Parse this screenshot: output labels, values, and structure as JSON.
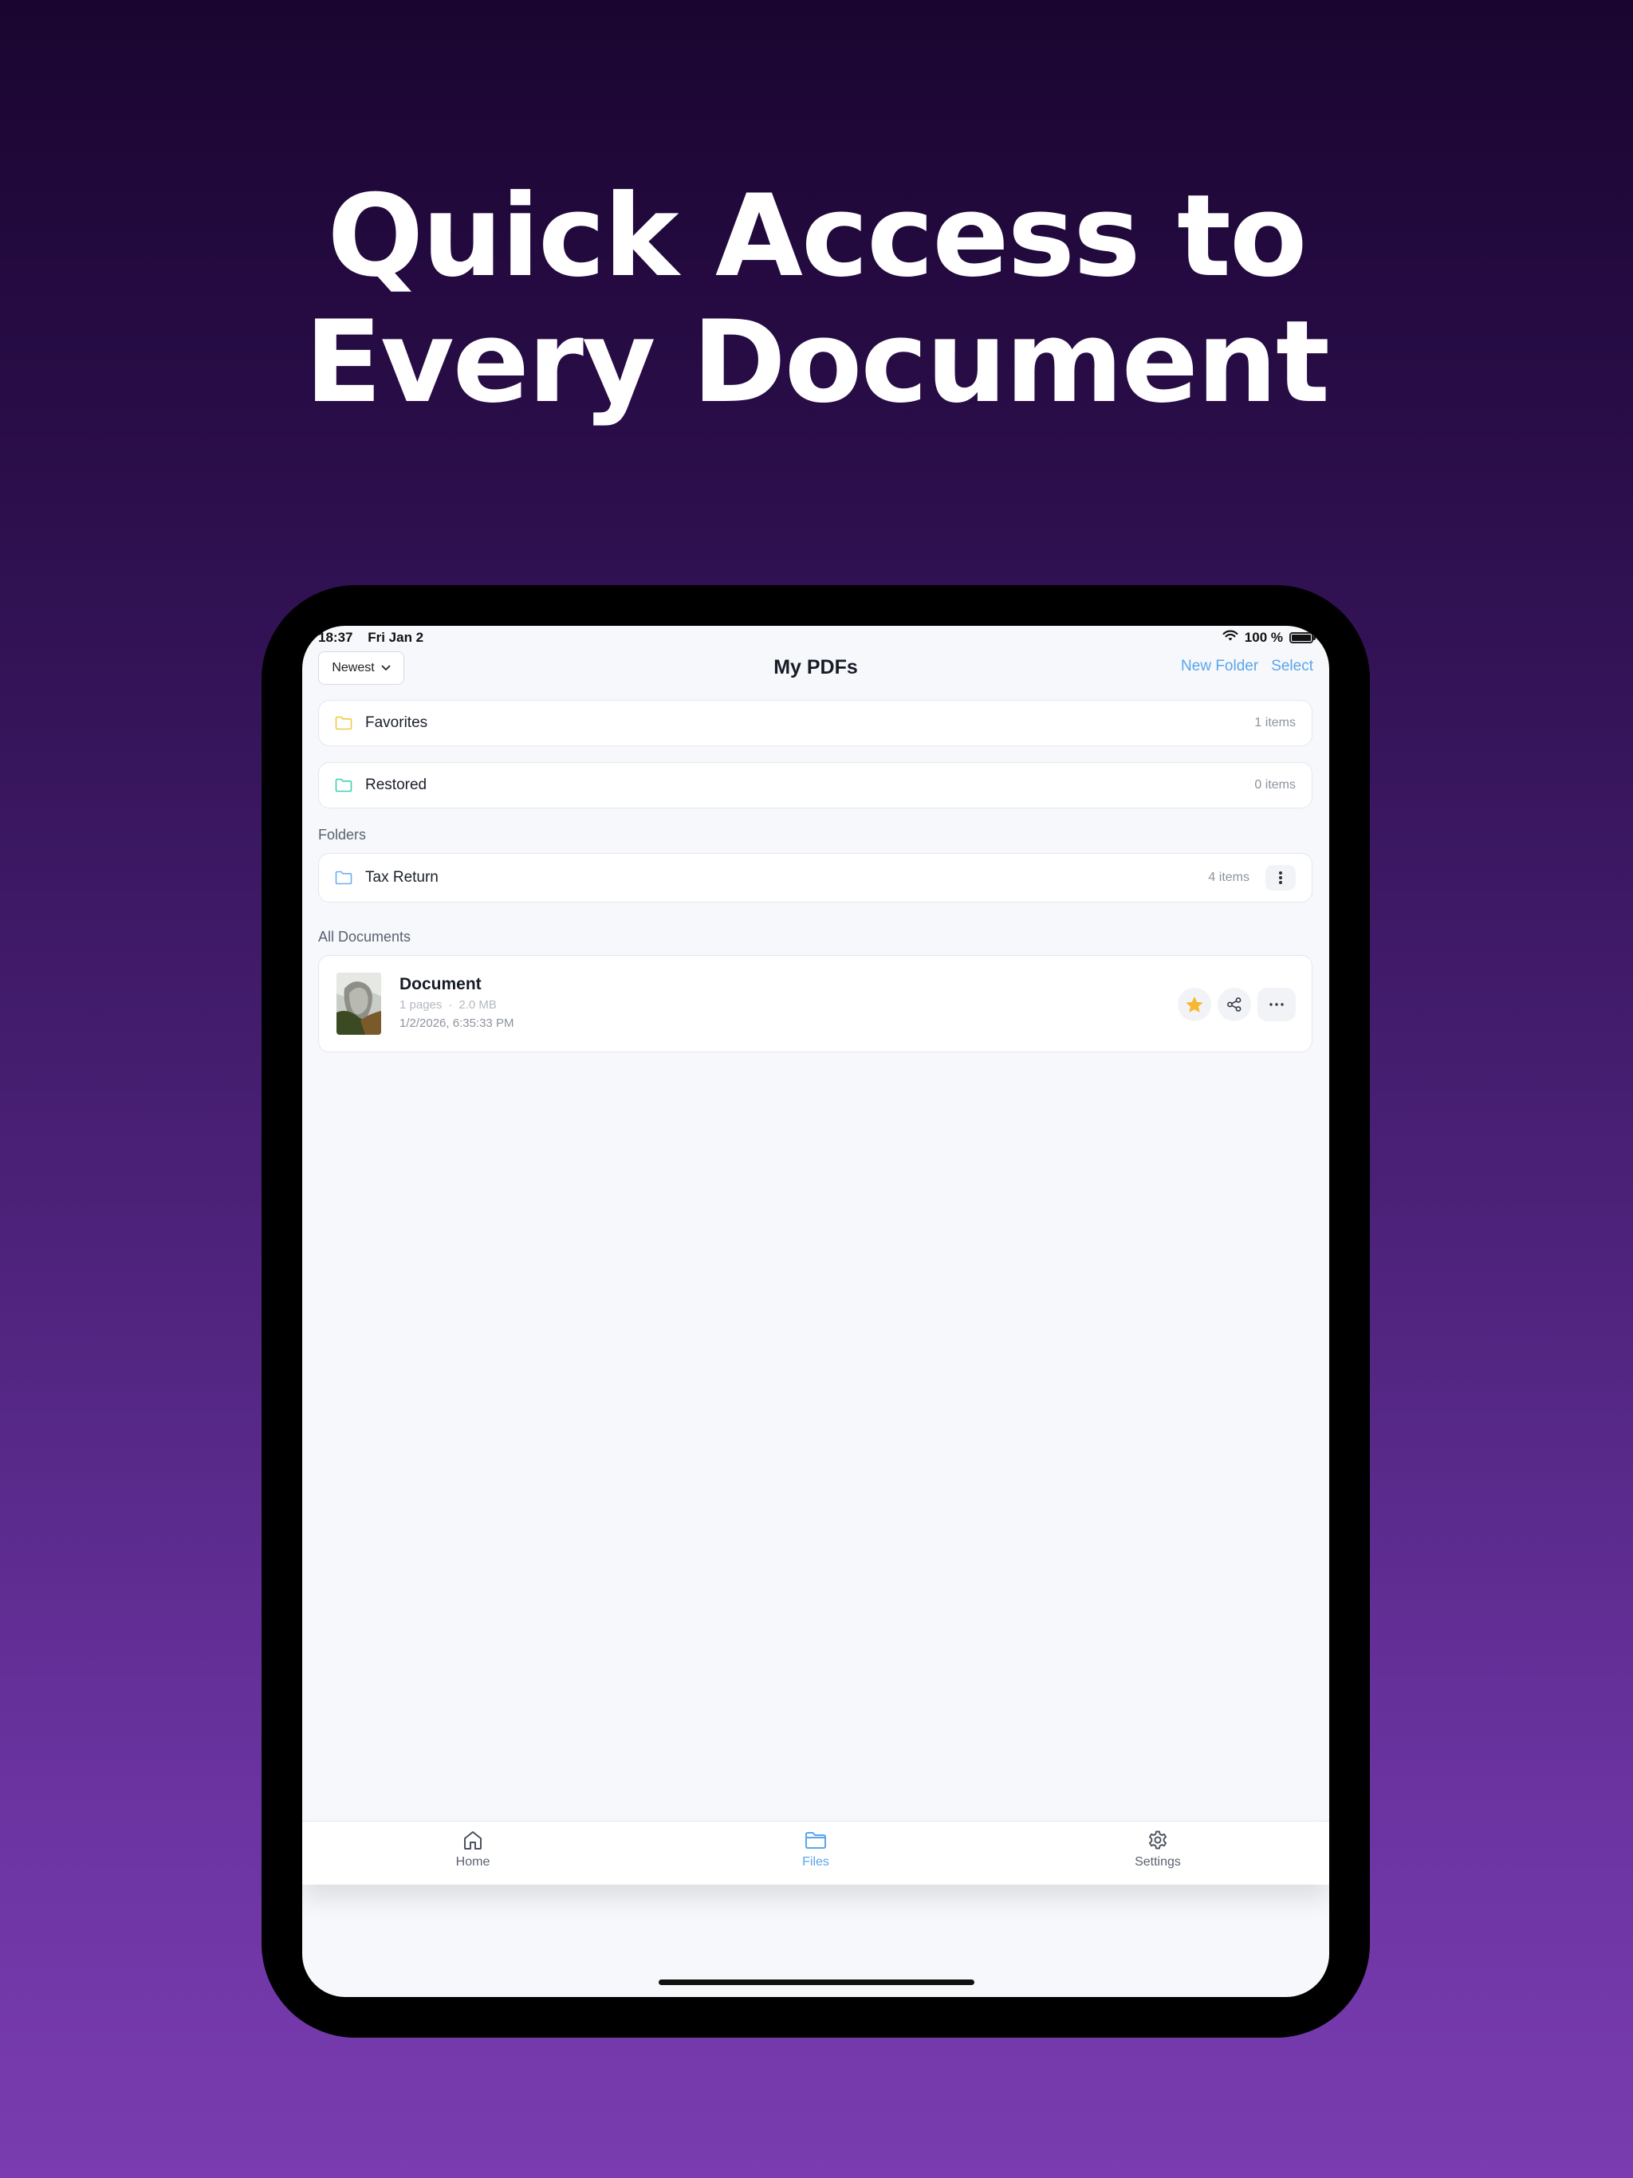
{
  "headline": {
    "line1": "Quick Access to",
    "line2": "Every Document"
  },
  "status_bar": {
    "time": "18:37",
    "date": "Fri Jan 2",
    "battery": "100 %",
    "icons": [
      "wifi-icon",
      "battery-icon"
    ]
  },
  "nav": {
    "sort_label": "Newest",
    "title": "My PDFs",
    "new_folder_label": "New Folder",
    "select_label": "Select"
  },
  "special_folders": [
    {
      "name": "Favorites",
      "count": "1 items",
      "icon": "folder-icon",
      "color": "#f5c842"
    },
    {
      "name": "Restored",
      "count": "0 items",
      "icon": "folder-icon",
      "color": "#3fd0b4"
    }
  ],
  "folders_section": {
    "label": "Folders",
    "items": [
      {
        "name": "Tax Return",
        "count": "4 items",
        "icon": "folder-icon",
        "color": "#6ab0f0"
      }
    ]
  },
  "documents_section": {
    "label": "All Documents",
    "items": [
      {
        "title": "Document",
        "pages": "1 pages",
        "size": "2.0 MB",
        "date": "1/2/2026, 6:35:33 PM",
        "favorite": true
      }
    ]
  },
  "tab_bar": {
    "tabs": [
      {
        "label": "Home",
        "icon": "home-icon",
        "active": false
      },
      {
        "label": "Files",
        "icon": "folder-icon",
        "active": true
      },
      {
        "label": "Settings",
        "icon": "gear-icon",
        "active": false
      }
    ]
  },
  "colors": {
    "accent": "#5aa6ec",
    "star": "#f5b82e",
    "background_top": "#1a0530",
    "background_bottom": "#7a3cb0"
  }
}
